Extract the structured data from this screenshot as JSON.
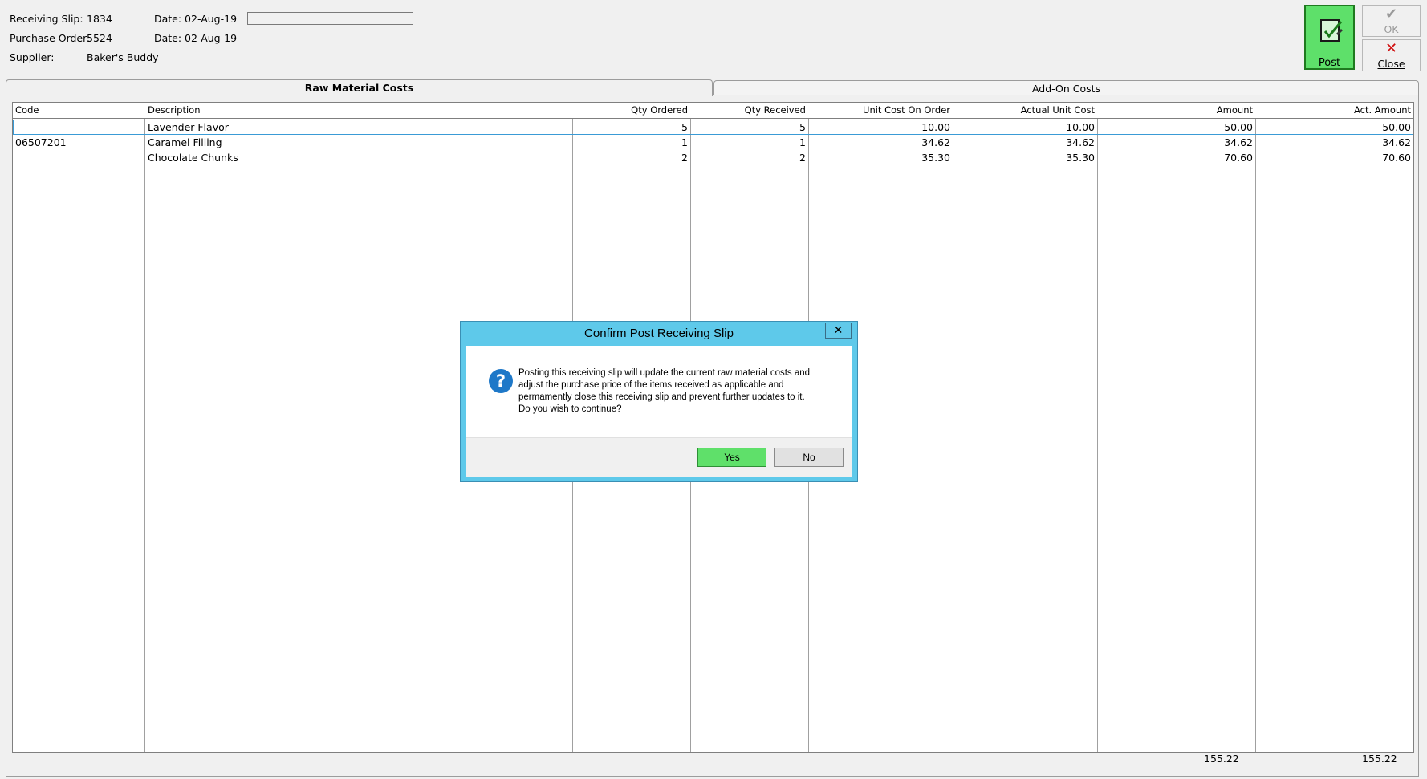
{
  "header": {
    "receiving_slip_label": "Receiving Slip:",
    "receiving_slip_value": "1834",
    "receiving_date": "Date: 02-Aug-19",
    "purchase_order_label": "Purchase Order:",
    "purchase_order_value": "5524",
    "po_date": "Date: 02-Aug-19",
    "supplier_label": "Supplier:",
    "supplier_value": "Baker's Buddy"
  },
  "toolbar": {
    "post_label": "Post",
    "ok_label": "OK",
    "close_label": "Close"
  },
  "tabs": [
    "Raw Material Costs",
    "Add-On Costs"
  ],
  "grid": {
    "columns": [
      "Code",
      "Description",
      "Qty Ordered",
      "Qty Received",
      "Unit Cost On Order",
      "Actual Unit Cost",
      "Amount",
      "Act. Amount"
    ],
    "rows": [
      {
        "code": "",
        "description": "Lavender Flavor",
        "qty_ordered": "5",
        "qty_received": "5",
        "unit_cost": "10.00",
        "actual_unit_cost": "10.00",
        "amount": "50.00",
        "act_amount": "50.00"
      },
      {
        "code": "06507201",
        "description": "Caramel Filling",
        "qty_ordered": "1",
        "qty_received": "1",
        "unit_cost": "34.62",
        "actual_unit_cost": "34.62",
        "amount": "34.62",
        "act_amount": "34.62"
      },
      {
        "code": "",
        "description": "Chocolate Chunks",
        "qty_ordered": "2",
        "qty_received": "2",
        "unit_cost": "35.30",
        "actual_unit_cost": "35.30",
        "amount": "70.60",
        "act_amount": "70.60"
      }
    ],
    "total_amount": "155.22",
    "total_act_amount": "155.22"
  },
  "dialog": {
    "title": "Confirm Post Receiving Slip",
    "close_glyph": "✕",
    "message_lines": [
      "Posting this receiving slip will update the current raw material costs and",
      "adjust the purchase price of the items received as applicable and",
      "permamently close this receiving slip and prevent further updates to it.",
      "Do you wish to continue?"
    ],
    "yes_label": "Yes",
    "no_label": "No",
    "icon": "question-icon"
  },
  "colors": {
    "post_green": "#5ee06a",
    "dialog_title_blue": "#5ec9ea",
    "selection_blue": "#3a9bd6",
    "close_red": "#d01010"
  }
}
